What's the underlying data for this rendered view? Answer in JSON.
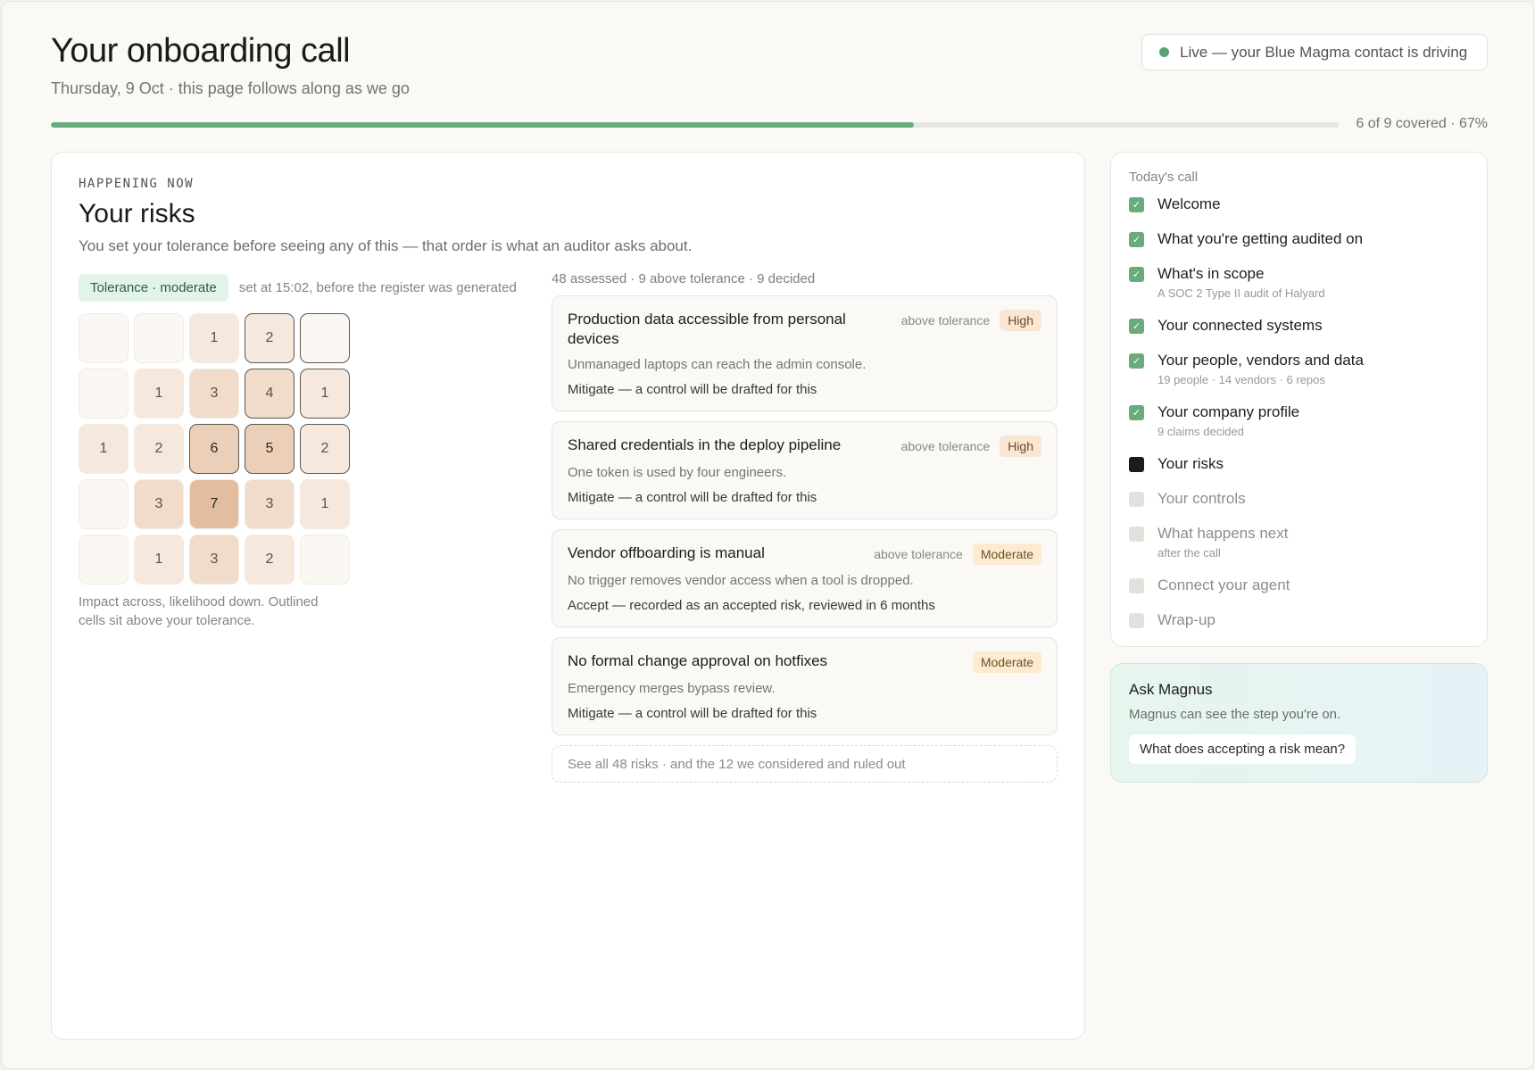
{
  "header": {
    "title": "Your onboarding call",
    "subtitle": "Thursday, 9 Oct · this page follows along as we go",
    "live": "Live — your Blue Magma contact is driving"
  },
  "progress": {
    "fraction": 0.67,
    "label": "6 of 9 covered · 67%"
  },
  "main": {
    "eyebrow": "HAPPENING NOW",
    "title": "Your risks",
    "description": "You set your tolerance before seeing any of this — that order is what an auditor asks about.",
    "tolerance_badge": "Tolerance · moderate",
    "tolerance_note": "set at 15:02, before the register was generated",
    "matrix": {
      "caption": "Impact across, likelihood down. Outlined cells sit above your tolerance.",
      "rows": [
        [
          null,
          null,
          1,
          2,
          null
        ],
        [
          null,
          1,
          3,
          4,
          1
        ],
        [
          1,
          2,
          6,
          5,
          2
        ],
        [
          null,
          3,
          7,
          3,
          1
        ],
        [
          null,
          1,
          3,
          2,
          null
        ]
      ],
      "above_tolerance": [
        [
          false,
          false,
          false,
          true,
          true
        ],
        [
          false,
          false,
          false,
          true,
          true
        ],
        [
          false,
          false,
          true,
          true,
          true
        ],
        [
          false,
          false,
          false,
          false,
          false
        ],
        [
          false,
          false,
          false,
          false,
          false
        ]
      ]
    },
    "risks_summary": "48 assessed · 9 above tolerance · 9 decided",
    "risks": [
      {
        "title": "Production data accessible from personal devices",
        "above": "above tolerance",
        "severity": "High",
        "description": "Unmanaged laptops can reach the admin console.",
        "action": "Mitigate — a control will be drafted for this"
      },
      {
        "title": "Shared credentials in the deploy pipeline",
        "above": "above tolerance",
        "severity": "High",
        "description": "One token is used by four engineers.",
        "action": "Mitigate — a control will be drafted for this"
      },
      {
        "title": "Vendor offboarding is manual",
        "above": "above tolerance",
        "severity": "Moderate",
        "description": "No trigger removes vendor access when a tool is dropped.",
        "action": "Accept — recorded as an accepted risk, reviewed in 6 months"
      },
      {
        "title": "No formal change approval on hotfixes",
        "above": "",
        "severity": "Moderate",
        "description": "Emergency merges bypass review.",
        "action": "Mitigate — a control will be drafted for this"
      }
    ],
    "see_all": "See all 48 risks · and the 12 we considered and ruled out"
  },
  "sidebar": {
    "heading": "Today's call",
    "steps": [
      {
        "label": "Welcome",
        "sub": "",
        "state": "done"
      },
      {
        "label": "What you're getting audited on",
        "sub": "",
        "state": "done"
      },
      {
        "label": "What's in scope",
        "sub": "A SOC 2 Type II audit of Halyard",
        "state": "done"
      },
      {
        "label": "Your connected systems",
        "sub": "",
        "state": "done"
      },
      {
        "label": "Your people, vendors and data",
        "sub": "19 people · 14 vendors · 6 repos",
        "state": "done"
      },
      {
        "label": "Your company profile",
        "sub": "9 claims decided",
        "state": "done"
      },
      {
        "label": "Your risks",
        "sub": "",
        "state": "current"
      },
      {
        "label": "Your controls",
        "sub": "",
        "state": "todo"
      },
      {
        "label": "What happens next",
        "sub": "after the call",
        "state": "todo"
      },
      {
        "label": "Connect your agent",
        "sub": "",
        "state": "todo"
      },
      {
        "label": "Wrap-up",
        "sub": "",
        "state": "todo"
      }
    ]
  },
  "ask": {
    "title": "Ask Magnus",
    "description": "Magnus can see the step you're on.",
    "chip": "What does accepting a risk mean?"
  },
  "colors": {
    "accent_green": "#6aab7e",
    "heat_levels": [
      "#fbf8f4",
      "#f6e8dc",
      "#f1dccb",
      "#ebcfb8",
      "#e2bd9f"
    ]
  }
}
